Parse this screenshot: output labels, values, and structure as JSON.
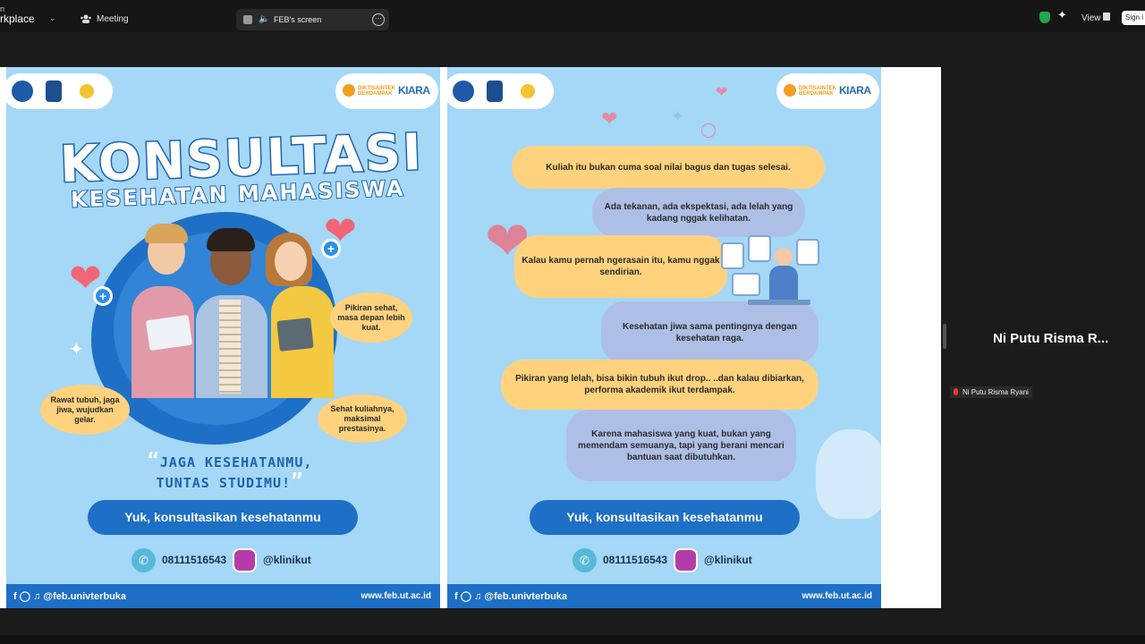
{
  "topbar": {
    "app_prefix": "n",
    "app_name": "rkplace",
    "meeting_label": "Meeting",
    "screen_label": "FEB's screen",
    "view_label": "View",
    "signin_label": "Sign i"
  },
  "poster_left": {
    "title": "KONSULTASI",
    "subtitle": "KESEHATAN MAHASISWA",
    "bubbles": [
      "Pikiran sehat, masa depan lebih kuat.",
      "Rawat tubuh, jaga jiwa, wujudkan gelar.",
      "Sehat kuliahnya, maksimal prestasinya."
    ],
    "quote_line1": "JAGA KESEHATANMU,",
    "quote_line2": "TUNTAS STUDIMU!",
    "cta": "Yuk, konsultasikan kesehatanmu",
    "phone": "08111516543",
    "instagram": "@klinikut",
    "social": "@feb.univterbuka",
    "url": "www.feb.ut.ac.id"
  },
  "poster_right": {
    "messages": [
      "Kuliah itu bukan cuma soal nilai bagus dan tugas selesai.",
      "Ada tekanan, ada ekspektasi, ada lelah yang kadang nggak kelihatan.",
      "Kalau kamu pernah ngerasain itu, kamu nggak sendirian.",
      "Kesehatan jiwa sama pentingnya dengan kesehatan raga.",
      "Pikiran yang lelah, bisa bikin tubuh ikut drop.. ..dan kalau dibiarkan, performa akademik ikut terdampak.",
      "Karena mahasiswa yang kuat, bukan yang memendam semuanya, tapi yang berani mencari bantuan saat dibutuhkan."
    ],
    "cta": "Yuk, konsultasikan kesehatanmu",
    "phone": "08111516543",
    "instagram": "@klinikut",
    "social": "@feb.univterbuka",
    "url": "www.feb.ut.ac.id"
  },
  "logos": {
    "kb_line1": "DIKTISAINTEK",
    "kb_line2": "BERDAMPAK",
    "kiara": "KIARA"
  },
  "participant": {
    "title": "Ni Putu Risma R...",
    "name": "Ni Putu Risma Ryani"
  },
  "colors": {
    "poster_bg": "#a5d7f7",
    "brand_blue": "#1e6fc6",
    "bubble_yellow": "#ffd27e",
    "bubble_violet": "#aebfe6"
  }
}
